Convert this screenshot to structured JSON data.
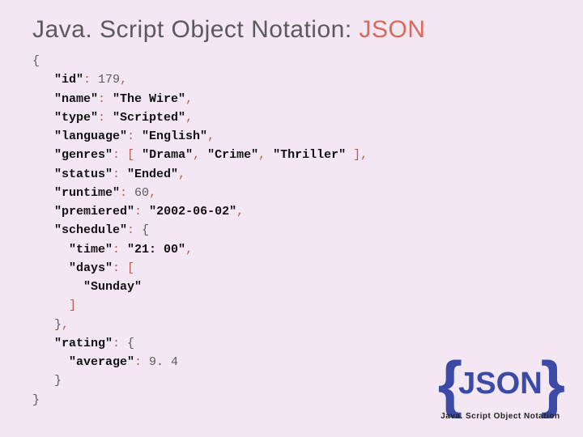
{
  "title": {
    "pre": "Java. Script Object Notation: ",
    "accent": "JSON"
  },
  "code": {
    "open": "{",
    "l01": {
      "key": "\"id\"",
      "colon": ": ",
      "val": "179",
      "comma": ","
    },
    "l02": {
      "key": "\"name\"",
      "colon": ": ",
      "val": "\"The Wire\"",
      "comma": ","
    },
    "l03": {
      "key": "\"type\"",
      "colon": ": ",
      "val": "\"Scripted\"",
      "comma": ","
    },
    "l04": {
      "key": "\"language\"",
      "colon": ": ",
      "val": "\"English\"",
      "comma": ","
    },
    "l05": {
      "key": "\"genres\"",
      "colon": ": ",
      "lb": "[ ",
      "v1": "\"Drama\"",
      "c1": ", ",
      "v2": "\"Crime\"",
      "c2": ", ",
      "v3": "\"Thriller\"",
      "rb": " ]",
      "comma": ","
    },
    "l06": {
      "key": "\"status\"",
      "colon": ": ",
      "val": "\"Ended\"",
      "comma": ","
    },
    "l07": {
      "key": "\"runtime\"",
      "colon": ": ",
      "val": "60",
      "comma": ","
    },
    "l08": {
      "key": "\"premiered\"",
      "colon": ": ",
      "val": "\"2002-06-02\"",
      "comma": ","
    },
    "l09": {
      "key": "\"schedule\"",
      "colon": ": ",
      "brace": "{"
    },
    "l10": {
      "key": "\"time\"",
      "colon": ": ",
      "val": "\"21: 00\"",
      "comma": ","
    },
    "l11": {
      "key": "\"days\"",
      "colon": ": ",
      "lb": "["
    },
    "l12": {
      "val": "\"Sunday\""
    },
    "l13": {
      "rb": "]"
    },
    "l14": {
      "brace": "}",
      "comma": ","
    },
    "l15": {
      "key": "\"rating\"",
      "colon": ": ",
      "brace": "{"
    },
    "l16": {
      "key": "\"average\"",
      "colon": ": ",
      "val": "9. 4"
    },
    "l17": {
      "brace": "}"
    },
    "close": "}"
  },
  "logo": {
    "lb": "{",
    "txt": "JSON",
    "rb": "}",
    "sub": "Java. Script Object Notation"
  }
}
